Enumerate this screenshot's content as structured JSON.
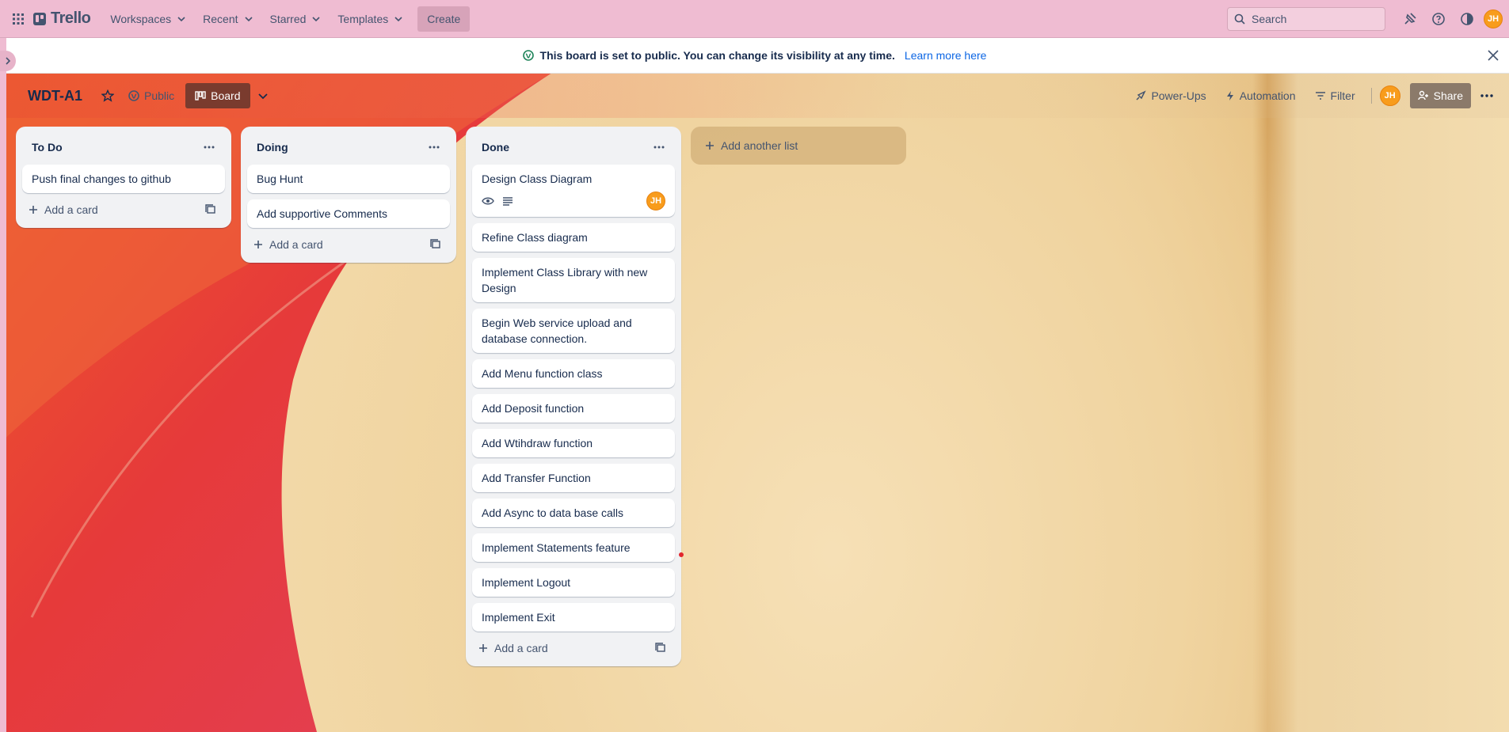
{
  "topnav": {
    "logo": "Trello",
    "items": [
      {
        "label": "Workspaces"
      },
      {
        "label": "Recent"
      },
      {
        "label": "Starred"
      },
      {
        "label": "Templates"
      }
    ],
    "create_label": "Create",
    "search_placeholder": "Search",
    "user_initials": "JH"
  },
  "banner": {
    "text": "This board is set to public. You can change its visibility at any time.",
    "link": "Learn more here"
  },
  "board": {
    "title": "WDT-A1",
    "visibility": "Public",
    "view": "Board",
    "powerups": "Power-Ups",
    "automation": "Automation",
    "filter": "Filter",
    "member_initials": "JH",
    "share": "Share"
  },
  "lists": [
    {
      "title": "To Do",
      "cards": [
        {
          "text": "Push final changes to github"
        }
      ],
      "add_card": "Add a card"
    },
    {
      "title": "Doing",
      "cards": [
        {
          "text": "Bug Hunt"
        },
        {
          "text": "Add supportive Comments"
        }
      ],
      "add_card": "Add a card"
    },
    {
      "title": "Done",
      "cards": [
        {
          "text": "Design Class Diagram",
          "has_badges": true,
          "member": "JH"
        },
        {
          "text": "Refine Class diagram"
        },
        {
          "text": "Implement Class Library with new Design"
        },
        {
          "text": "Begin Web service upload and database connection."
        },
        {
          "text": "Add Menu function class"
        },
        {
          "text": "Add Deposit function"
        },
        {
          "text": "Add Wtihdraw function"
        },
        {
          "text": "Add Transfer Function"
        },
        {
          "text": "Add Async to data base calls"
        },
        {
          "text": "Implement Statements feature"
        },
        {
          "text": "Implement Logout"
        },
        {
          "text": "Implement Exit"
        }
      ],
      "add_card": "Add a card"
    }
  ],
  "add_list": "Add another list",
  "colors": {
    "nav_bg": "#efbcd2",
    "board_btn": "#7a3b2e",
    "avatar": "#f89c1c",
    "link": "#0c66e4"
  }
}
